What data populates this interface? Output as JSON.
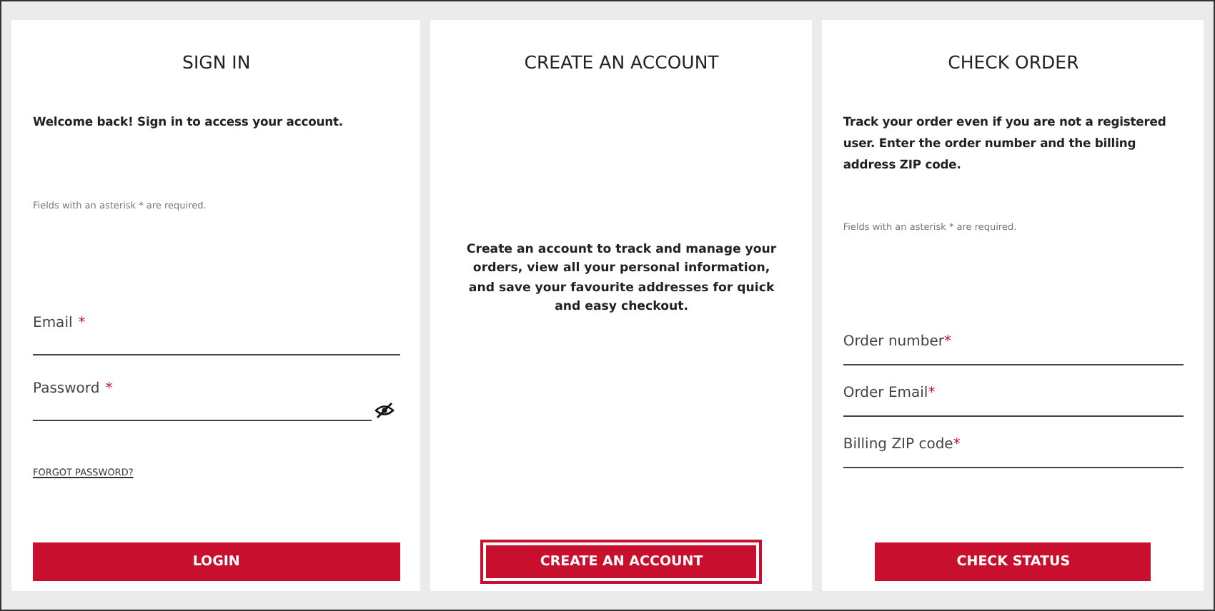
{
  "panels": [
    {
      "title": "SIGN IN",
      "intro": "Welcome back! Sign in to access your account.",
      "note": "Fields with an asterisk * are required.",
      "fields": [
        {
          "kind": "text",
          "label": "Email",
          "required_mark": "*"
        },
        {
          "kind": "password",
          "label": "Password",
          "required_mark": "*",
          "masked": true
        }
      ],
      "link": "FORGOT PASSWORD?",
      "button": {
        "label": "LOGIN",
        "focused": false,
        "full_width": true
      }
    },
    {
      "title": "CREATE AN ACCOUNT",
      "message": "Create an account to track and manage your orders, view all your personal information, and save your favourite addresses for quick and easy checkout.",
      "button": {
        "label": "CREATE AN ACCOUNT",
        "focused": true,
        "full_width": false
      }
    },
    {
      "title": "CHECK ORDER",
      "intro": "Track your order even if you are not a registered user. Enter the order number and the billing address ZIP code.",
      "note": "Fields with an asterisk * are required.",
      "fields": [
        {
          "kind": "text",
          "label": "Order number",
          "required_mark": "*"
        },
        {
          "kind": "text",
          "label": "Order Email",
          "required_mark": "*"
        },
        {
          "kind": "text",
          "label": "Billing ZIP code",
          "required_mark": "*"
        }
      ],
      "button": {
        "label": "CHECK STATUS",
        "focused": false,
        "full_width": false
      }
    }
  ]
}
